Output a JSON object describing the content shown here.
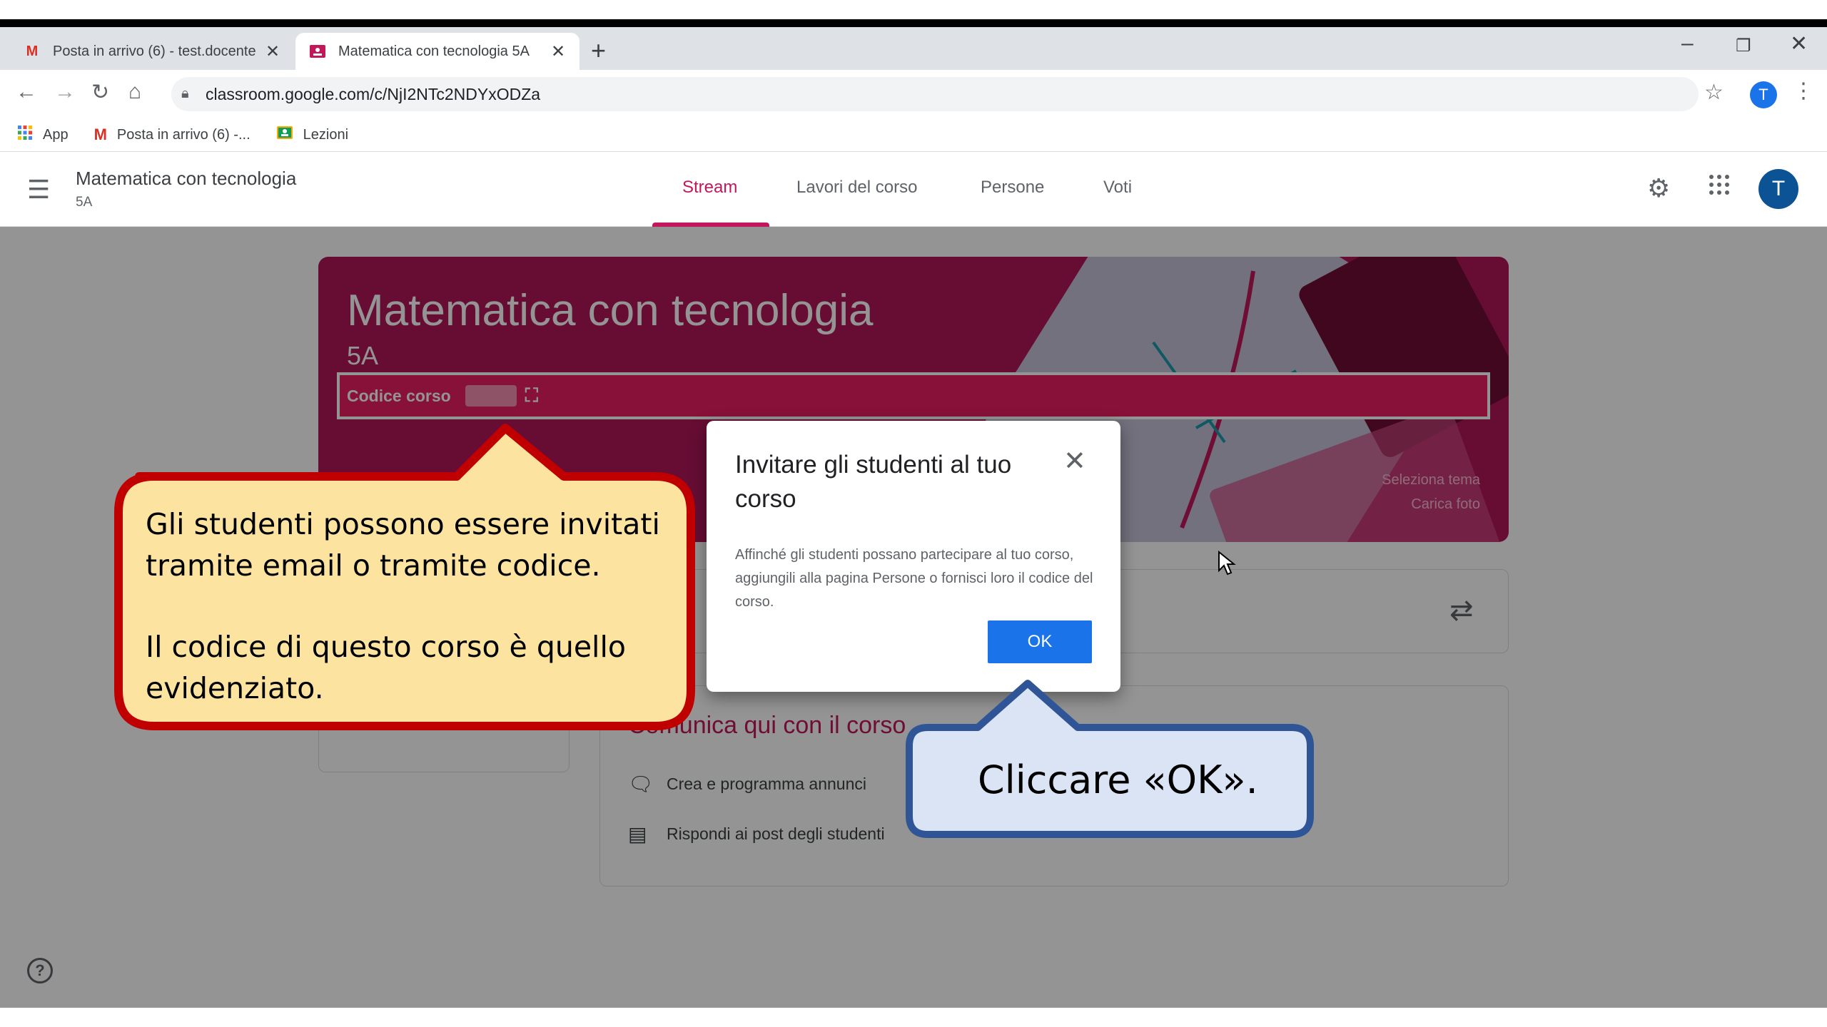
{
  "browser": {
    "tabs": [
      {
        "label": "Posta in arrivo (6) - test.docente",
        "favicon": "gmail-icon",
        "active": false
      },
      {
        "label": "Matematica con tecnologia 5A",
        "favicon": "classroom-icon",
        "active": true
      }
    ],
    "new_tab_symbol": "+",
    "url": "classroom.google.com/c/NjI2NTc2NDYxODZa",
    "profile_initial": "T",
    "bookmarks": [
      {
        "label": "App",
        "icon": "apps-grid-icon"
      },
      {
        "label": "Posta in arrivo (6) -...",
        "icon": "gmail-icon"
      },
      {
        "label": "Lezioni",
        "icon": "classroom-icon"
      }
    ]
  },
  "classroom": {
    "course_title": "Matematica con tecnologia",
    "course_section": "5A",
    "nav_tabs": [
      {
        "label": "Stream",
        "active": true
      },
      {
        "label": "Lavori del corso",
        "active": false
      },
      {
        "label": "Persone",
        "active": false
      },
      {
        "label": "Voti",
        "active": false
      }
    ],
    "avatar_initial": "T",
    "banner": {
      "title": "Matematica con tecnologia",
      "section": "5A",
      "code_label": "Codice corso",
      "select_theme": "Seleziona tema",
      "upload_photo": "Carica foto"
    },
    "stream": {
      "heading": "Comunica qui con il corso",
      "items": [
        {
          "label": "Crea e programma annunci",
          "icon": "comment-icon"
        },
        {
          "label": "Rispondi ai post degli studenti",
          "icon": "reply-icon"
        }
      ]
    }
  },
  "dialog": {
    "title": "Invitare gli studenti al tuo corso",
    "body": "Affinché gli studenti possano partecipare al tuo corso, aggiungili alla pagina Persone o fornisci loro il codice del corso.",
    "ok_label": "OK"
  },
  "callouts": {
    "left_line1": "Gli studenti possono essere invitati",
    "left_line2": "tramite email o tramite codice.",
    "left_line3": "Il codice di questo corso è quello",
    "left_line4": "evidenziato.",
    "right": "Cliccare «OK»."
  },
  "colors": {
    "accent": "#c2185b",
    "banner": "#b2185a",
    "code_bar": "#e91e63",
    "ok_button": "#1a73e8",
    "callout_left_fill": "#fde3a0",
    "callout_left_border": "#c00000",
    "callout_right_fill": "#dbe4f4",
    "callout_right_border": "#2f5597"
  }
}
